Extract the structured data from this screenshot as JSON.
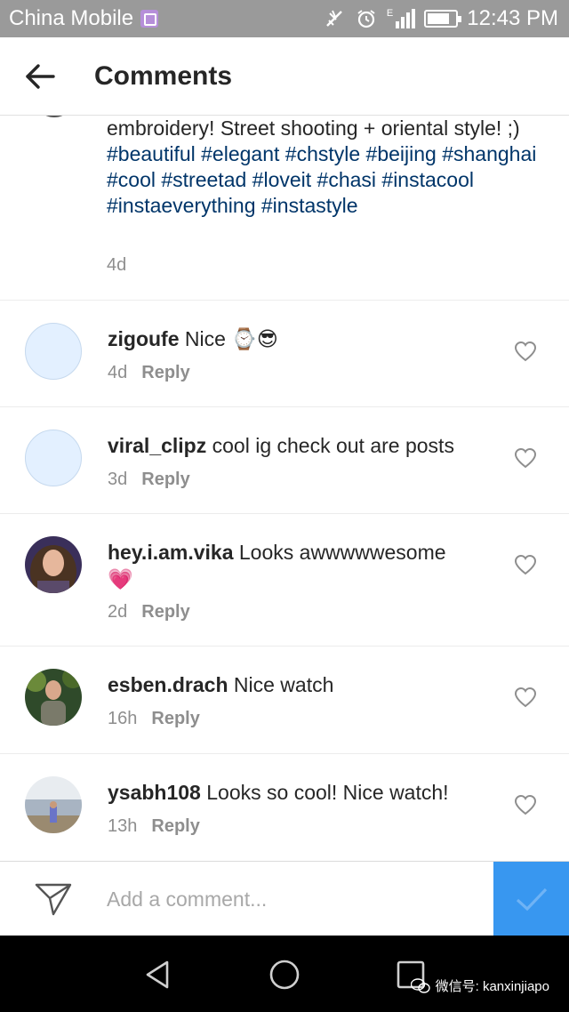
{
  "status_bar": {
    "carrier": "China Mobile",
    "time": "12:43 PM",
    "network_label": "E"
  },
  "header": {
    "title": "Comments"
  },
  "caption": {
    "text": "embroidery! Street shooting + oriental style! ;)",
    "hashtags": "#beautiful #elegant #chstyle #beijing #shanghai #cool #streetad #loveit #chasi #instacool #instaeverything #instastyle",
    "time": "4d"
  },
  "comments": [
    {
      "username": "zigoufe",
      "text": "Nice ⌚😎",
      "time": "4d",
      "reply_label": "Reply",
      "avatar": "placeholder"
    },
    {
      "username": "viral_clipz",
      "text": "cool ig check out are posts",
      "time": "3d",
      "reply_label": "Reply",
      "avatar": "placeholder"
    },
    {
      "username": "hey.i.am.vika",
      "text": "Looks awwwwwesome",
      "emoji": "💗",
      "time": "2d",
      "reply_label": "Reply",
      "avatar": "photo"
    },
    {
      "username": "esben.drach",
      "text": "Nice watch",
      "time": "16h",
      "reply_label": "Reply",
      "avatar": "photo"
    },
    {
      "username": "ysabh108",
      "text": "Looks so cool! Nice watch!",
      "time": "13h",
      "reply_label": "Reply",
      "avatar": "photo"
    }
  ],
  "input_bar": {
    "placeholder": "Add a comment..."
  },
  "watermark": {
    "text": "微信号: kanxinjiapo"
  },
  "colors": {
    "accent": "#3897f0",
    "hashtag": "#003569",
    "status_bar": "#9a9a9a",
    "secondary_text": "#8e8e8e"
  },
  "icons": [
    "back-arrow-icon",
    "heart-outline-icon",
    "send-icon",
    "checkmark-icon",
    "nav-back-icon",
    "nav-home-icon",
    "nav-recents-icon",
    "wechat-icon"
  ]
}
